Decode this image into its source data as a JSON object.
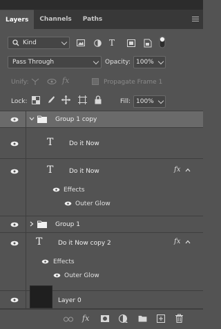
{
  "tabs": [
    {
      "label": "Layers",
      "active": true
    },
    {
      "label": "Channels",
      "active": false
    },
    {
      "label": "Paths",
      "active": false
    }
  ],
  "filter": {
    "kind_label": "Kind",
    "icons": [
      "image-filter-icon",
      "adjustment-filter-icon",
      "type-filter-icon",
      "shape-filter-icon",
      "smartobject-filter-icon",
      "filter-toggle-icon"
    ]
  },
  "blend": {
    "mode": "Pass Through",
    "opacity_label": "Opacity:",
    "opacity_value": "100%"
  },
  "unify": {
    "label": "Unify:",
    "propagate_label": "Propagate Frame 1"
  },
  "lock": {
    "label": "Lock:",
    "fill_label": "Fill:",
    "fill_value": "100%"
  },
  "layers": [
    {
      "name": "Group 1 copy",
      "type": "group",
      "expanded": true,
      "selected": true
    },
    {
      "name": "Do it Now",
      "type": "text"
    },
    {
      "name": "Do it Now",
      "type": "text",
      "fx": "fx",
      "effects_label": "Effects",
      "effect": "Outer Glow"
    },
    {
      "name": "Group 1",
      "type": "group",
      "expanded": false
    },
    {
      "name": "Do it Now copy 2",
      "type": "text",
      "fx": "fx",
      "effects_label": "Effects",
      "effect": "Outer Glow"
    },
    {
      "name": "Layer 0",
      "type": "pixel"
    }
  ],
  "bottom_icons": [
    "link-icon",
    "fx-icon",
    "mask-icon",
    "adjustment-icon",
    "folder-icon",
    "new-layer-icon",
    "trash-icon"
  ],
  "colors": {
    "panel": "#535353",
    "selected": "#6a6a6a",
    "tabbar": "#383838"
  }
}
